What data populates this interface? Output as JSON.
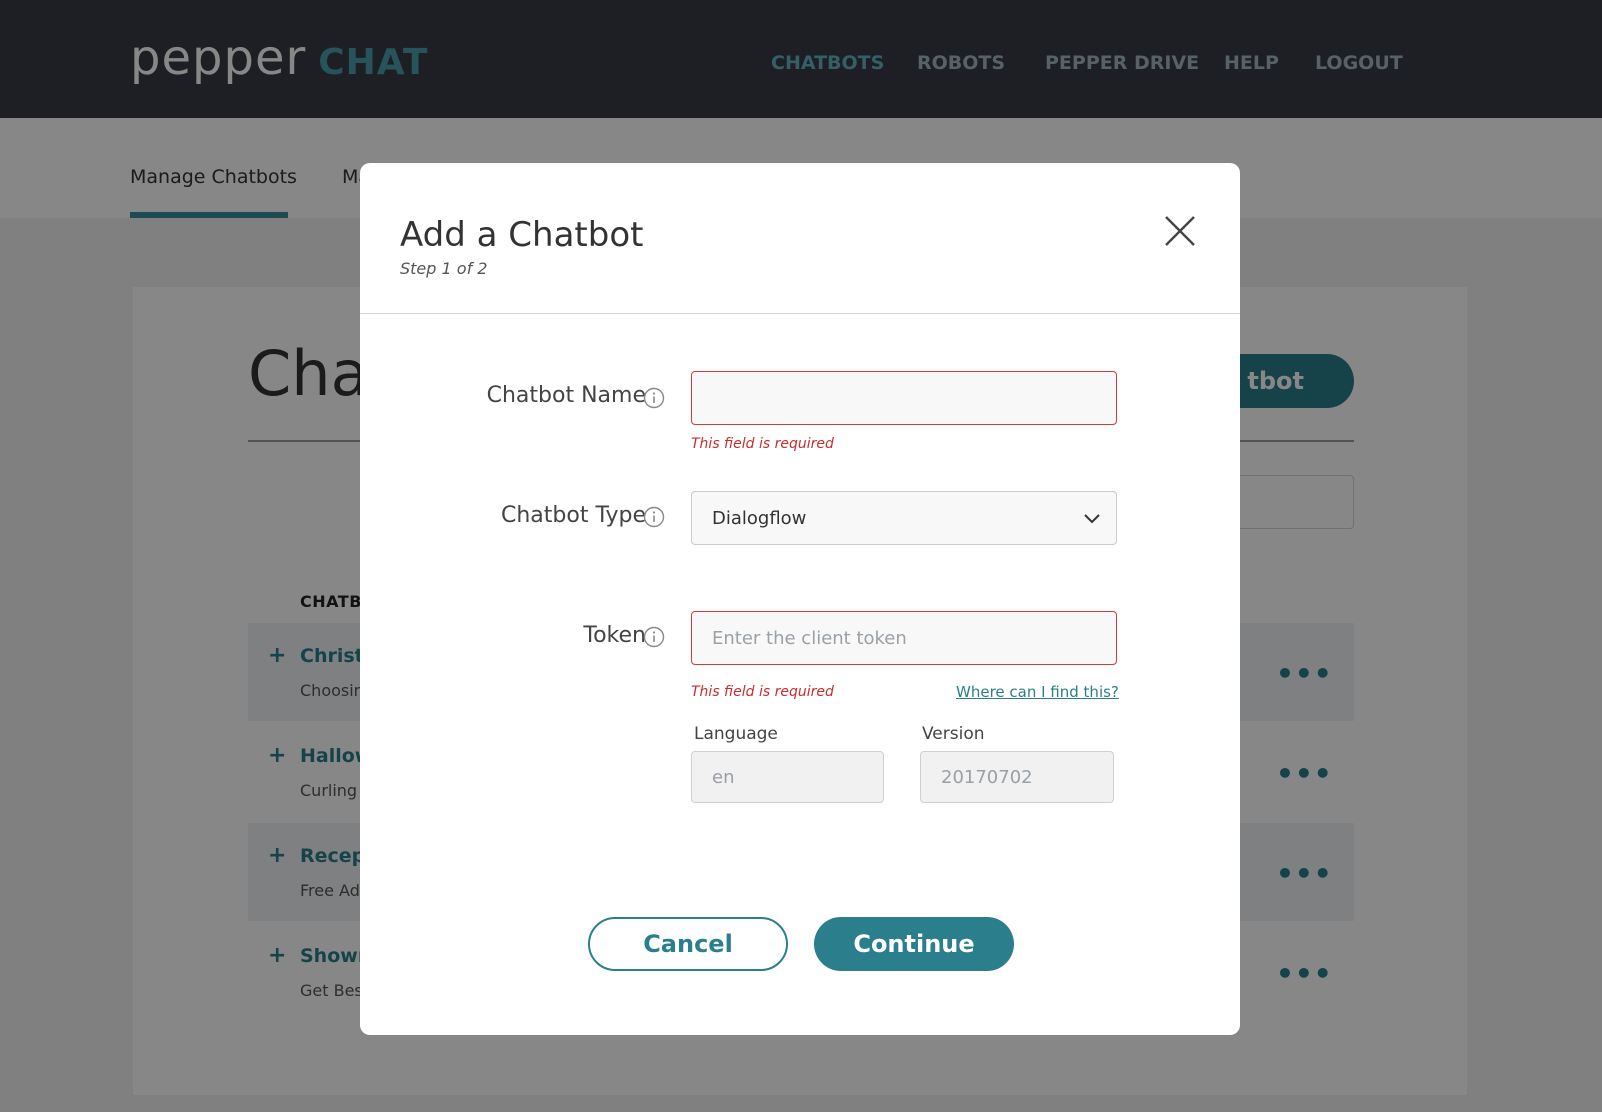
{
  "header": {
    "logo_primary": "pepper",
    "logo_secondary": "CHAT",
    "nav": [
      {
        "label": "CHATBOTS",
        "active": true
      },
      {
        "label": "ROBOTS",
        "active": false
      },
      {
        "label": "PEPPER DRIVE",
        "active": false
      },
      {
        "label": "HELP",
        "active": false
      },
      {
        "label": "LOGOUT",
        "active": false
      }
    ]
  },
  "subnav": {
    "tabs": [
      {
        "label": "Manage Chatbots",
        "active": true
      },
      {
        "label": "Ma",
        "active": false
      }
    ]
  },
  "background_page": {
    "title": "Chat",
    "add_button_label": "tbot",
    "column_header": "CHATB",
    "rows": [
      {
        "name": "Christm",
        "desc": "Choosin",
        "actions": "•••"
      },
      {
        "name": "Hallow",
        "desc": "Curling",
        "actions": "•••"
      },
      {
        "name": "Recept",
        "desc": "Free Ad",
        "actions": "•••"
      },
      {
        "name": "Showro",
        "desc": "Get Best",
        "actions": "•••"
      }
    ]
  },
  "modal": {
    "title": "Add a Chatbot",
    "step": "Step 1 of 2",
    "fields": {
      "name": {
        "label": "Chatbot Name",
        "value": "",
        "error": "This field is required"
      },
      "type": {
        "label": "Chatbot Type",
        "value": "Dialogflow"
      },
      "token": {
        "label": "Token",
        "placeholder": "Enter the client token",
        "error": "This field is required",
        "help_link": "Where can I find this?"
      },
      "language": {
        "label": "Language",
        "value": "en"
      },
      "version": {
        "label": "Version",
        "value": "20170702"
      }
    },
    "buttons": {
      "cancel": "Cancel",
      "continue": "Continue"
    }
  },
  "colors": {
    "accent": "#2b7f8d",
    "error": "#cf3a3a",
    "topbar": "#373b44"
  }
}
